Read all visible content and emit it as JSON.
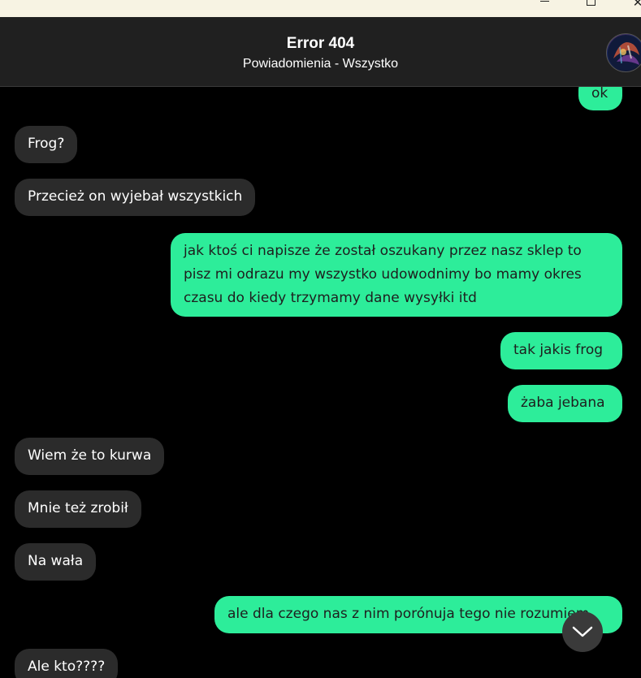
{
  "window": {
    "minimize_icon": "minimize-icon",
    "maximize_icon": "maximize-icon",
    "close_icon": "close-icon",
    "close_glyph": "✕"
  },
  "header": {
    "title": "Error 404",
    "subtitle": "Powiadomienia - Wszystko",
    "avatar_icon": "avatar"
  },
  "messages": [
    {
      "direction": "out",
      "text": "ok"
    },
    {
      "direction": "in",
      "text": "Frog?"
    },
    {
      "direction": "in",
      "text": "Przecież on wyjebał wszystkich"
    },
    {
      "direction": "out",
      "text": "jak ktoś ci napisze że został oszukany przez nasz sklep to pisz mi odrazu my wszystko udowodnimy bo mamy okres czasu do kiedy trzymamy dane wysyłki itd"
    },
    {
      "direction": "out",
      "text": "tak jakis frog"
    },
    {
      "direction": "out",
      "text": "żaba jebana"
    },
    {
      "direction": "in",
      "text": "Wiem że to kurwa"
    },
    {
      "direction": "in",
      "text": "Mnie też zrobił"
    },
    {
      "direction": "in",
      "text": "Na wała"
    },
    {
      "direction": "out",
      "text": "ale dla czego nas z nim porónuja tego nie rozumiem"
    },
    {
      "direction": "in",
      "text": "Ale kto????"
    }
  ],
  "colors": {
    "outgoing_bubble": "#2ded9a",
    "incoming_bubble": "#2b2b2b",
    "background": "#000000",
    "header": "#202020"
  },
  "scroll_button_icon": "chevron-down-icon"
}
